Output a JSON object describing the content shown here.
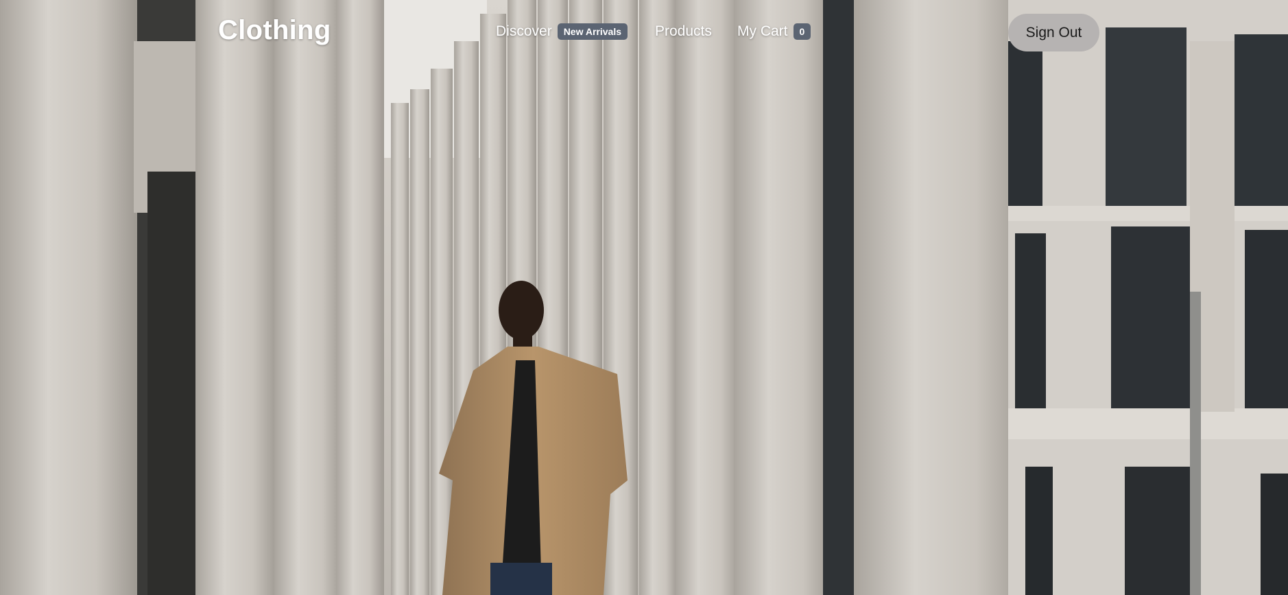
{
  "brand": {
    "name": "Clothing"
  },
  "nav": {
    "discover": {
      "label": "Discover",
      "badge": "New Arrivals"
    },
    "products": {
      "label": "Products"
    },
    "cart": {
      "label": "My Cart",
      "count": "0"
    }
  },
  "auth": {
    "signout_label": "Sign Out"
  },
  "colors": {
    "badge_bg": "#5b6472",
    "signout_bg": "#b6b3b2",
    "text": "#ffffff"
  },
  "hero": {
    "image": "man-in-camel-coat-walking-past-stone-columns"
  }
}
